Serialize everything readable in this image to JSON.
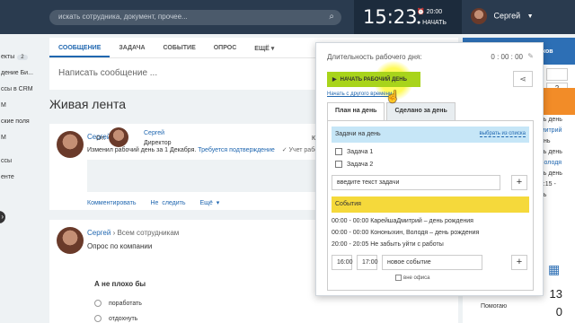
{
  "header": {
    "search_placeholder": "искать сотрудника, документ, прочее...",
    "clock": "15:23",
    "alarm": "⏰ 20:00",
    "start_label": "● НАЧАТЬ",
    "user_name": "Сергей"
  },
  "sidebar": {
    "items": [
      {
        "label": "екты",
        "count": "2"
      },
      {
        "label": "дение Би..."
      },
      {
        "label": "ссы в CRM"
      },
      {
        "label": "M"
      },
      {
        "label": "ские поля"
      },
      {
        "label": "M"
      },
      {
        "label": "ссы"
      },
      {
        "label": "енте"
      }
    ]
  },
  "composer": {
    "tabs": [
      "СООБЩЕНИЕ",
      "ЗАДАЧА",
      "СОБЫТИЕ",
      "ОПРОС",
      "ЕЩЁ ▾"
    ],
    "placeholder": "Написать сообщение ..."
  },
  "feed": {
    "title": "Живая лента",
    "post1": {
      "author": "Сергей",
      "action": "Изменил рабочий день за 1 Декабря.",
      "warning": "Требуется подтверждение",
      "check": "✓ Учет рабочего",
      "from_label": "От:",
      "from_name": "Сергей",
      "from_role": "Директор",
      "to_label": "Кому",
      "links": [
        "Комментировать",
        "Не следить",
        "Ещё ▾"
      ]
    },
    "post2": {
      "author": "Сергей",
      "recipients": "› Всем сотрудникам",
      "subject": "Опрос по компании",
      "question": "А не плохо бы",
      "options": [
        "поработать",
        "отдохнуть"
      ]
    }
  },
  "right": {
    "banner": "ников",
    "box_values": [
      "",
      "2"
    ],
    "events": [
      {
        "text": "ень день",
        "link": false
      },
      {
        "text": "Дмитрий",
        "link": true
      },
      {
        "text": "день",
        "link": false
      },
      {
        "text": "ень день",
        "link": false
      },
      {
        "text": ", Володя",
        "link": true
      },
      {
        "text": "ень день",
        "link": false
      },
      {
        "text": "",
        "link": false
      },
      {
        "text": "12:15 -",
        "link": false
      },
      {
        "text": "ень",
        "link": false
      }
    ],
    "calendar_glyph": "▦",
    "bottom": [
      {
        "label": "",
        "num": "13"
      },
      {
        "label": "Помогаю",
        "num": "0"
      }
    ]
  },
  "popup": {
    "title": "Длительность рабочего дня:",
    "time": "0 : 00 : 00",
    "start_button": "НАЧАТЬ РАБОЧИЙ ДЕНЬ",
    "other_time": "Начать с другого времени",
    "tabs": [
      "План на день",
      "Сделано за день"
    ],
    "tasks_head": "Задачи на день",
    "choose_link": "выбрать из списка",
    "tasks": [
      "Задача 1",
      "Задача 2"
    ],
    "task_placeholder": "введите текст задачи",
    "events_head": "События",
    "events": [
      "00:00 - 00:00  КарейшаДмитрий – день рождения",
      "00:00 - 00:00  Кононыхин, Володя – день рождения",
      "20:00 - 20:05  Не забыть уйти с работы"
    ],
    "event_from": "16:00",
    "event_to": "17:00",
    "event_placeholder": "новое событие",
    "outside_office": "вне офиса"
  }
}
